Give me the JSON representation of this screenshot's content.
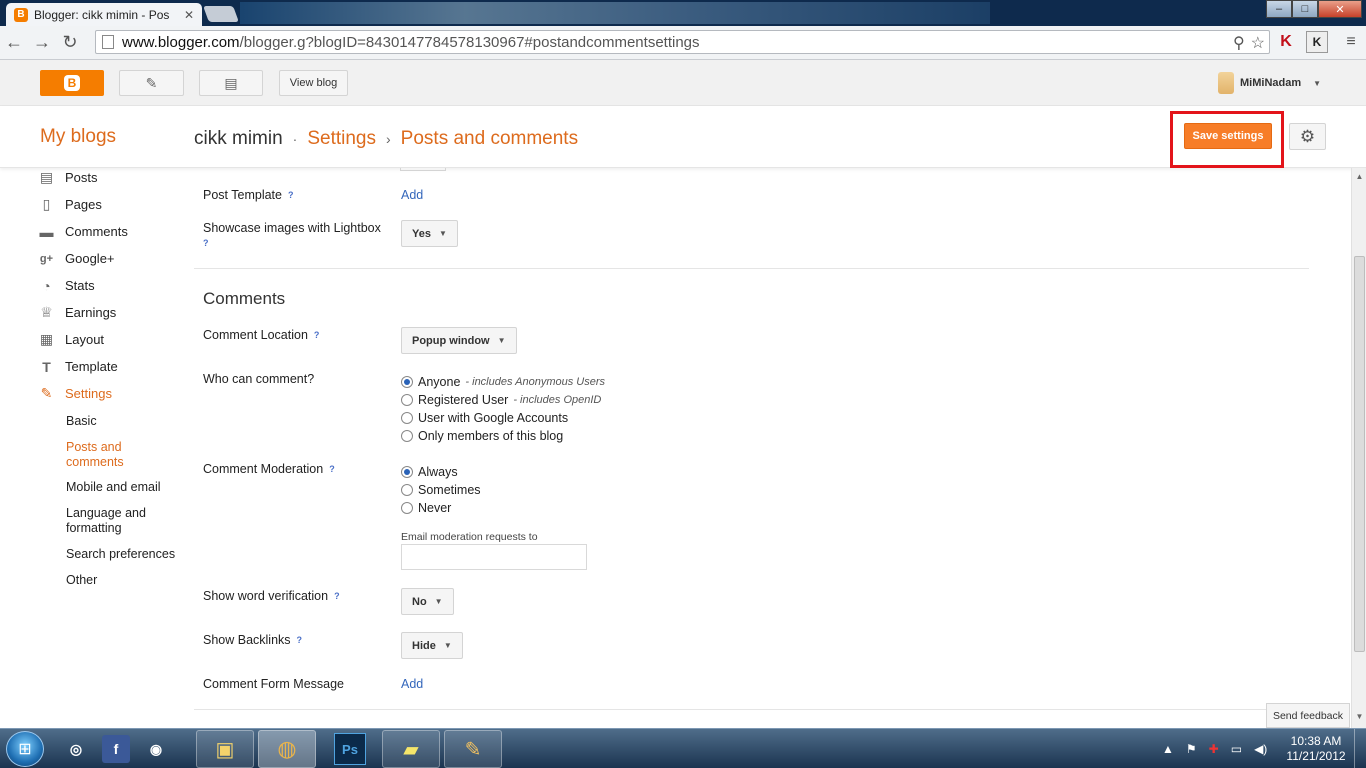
{
  "browser": {
    "tab_title": "Blogger: cikk mimin - Pos",
    "tab_close": "✕",
    "favicon_letter": "B",
    "url_host": "www.blogger.com",
    "url_path": "/blogger.g?blogID=8430147784578130967#postandcommentsettings",
    "window_controls": {
      "minimize": "–",
      "maximize": "□",
      "close": "✕"
    },
    "nav": {
      "back": "←",
      "forward": "→",
      "reload": "↻"
    },
    "omnibox_icons": {
      "search": "⚲",
      "star": "☆"
    },
    "extensions": {
      "kaspersky": "K",
      "k_ext": "K",
      "menu": "≡"
    }
  },
  "blogger_header": {
    "logo_letter": "B",
    "new_post_icon": "✎",
    "posts_icon": "▤",
    "view_blog": "View blog",
    "username": "MiMiNadam",
    "user_caret": "▼"
  },
  "titlebar": {
    "my_blogs": "My blogs",
    "blog_name": "cikk mimin",
    "sep1": "·",
    "settings_link": "Settings",
    "sep2": "›",
    "page": "Posts and comments",
    "save_button": "Save settings",
    "gear_icon": "⚙"
  },
  "sidebar": {
    "items": [
      {
        "label": "Posts",
        "icon": "▤"
      },
      {
        "label": "Pages",
        "icon": "▯"
      },
      {
        "label": "Comments",
        "icon": "▬"
      },
      {
        "label": "Google+",
        "icon": "g+"
      },
      {
        "label": "Stats",
        "icon": "◔"
      },
      {
        "label": "Earnings",
        "icon": "♕"
      },
      {
        "label": "Layout",
        "icon": "▦"
      },
      {
        "label": "Template",
        "icon": "T"
      },
      {
        "label": "Settings",
        "icon": "✎"
      }
    ],
    "sub_items": [
      "Basic",
      "Posts and comments",
      "Mobile and email",
      "Language and formatting",
      "Search preferences",
      "Other"
    ]
  },
  "posts_section": {
    "post_template_label": "Post Template",
    "post_template_link": "Add",
    "lightbox_label": "Showcase images with Lightbox",
    "lightbox_value": "Yes",
    "help": "?"
  },
  "comments_section": {
    "title": "Comments",
    "location_label": "Comment Location",
    "location_value": "Popup window",
    "who_label": "Who can comment?",
    "who_options": [
      {
        "label": "Anyone",
        "note": " - includes Anonymous Users",
        "selected": true
      },
      {
        "label": "Registered User",
        "note": " - includes OpenID",
        "selected": false
      },
      {
        "label": "User with Google Accounts",
        "note": "",
        "selected": false
      },
      {
        "label": "Only members of this blog",
        "note": "",
        "selected": false
      }
    ],
    "moderation_label": "Comment Moderation",
    "moderation_options": [
      {
        "label": "Always",
        "selected": true
      },
      {
        "label": "Sometimes",
        "selected": false
      },
      {
        "label": "Never",
        "selected": false
      }
    ],
    "email_moderation_label": "Email moderation requests to",
    "email_moderation_value": "",
    "word_verification_label": "Show word verification",
    "word_verification_value": "No",
    "backlinks_label": "Show Backlinks",
    "backlinks_value": "Hide",
    "form_message_label": "Comment Form Message",
    "form_message_link": "Add",
    "dropdown_caret": "▼"
  },
  "feedback": "Send feedback",
  "taskbar": {
    "start_icon": "⊞",
    "pinned": [
      "◎",
      "f",
      "◉",
      "▣",
      "◍",
      "Ps",
      "▰",
      "✎"
    ],
    "tray_icons": [
      "▲",
      "⚑",
      "✚",
      "▭",
      "◀)"
    ],
    "time": "10:38 AM",
    "date": "11/21/2012"
  },
  "colors": {
    "accent": "#dd6b1d",
    "save_button": "#f77d28",
    "highlight_box": "#e3141a",
    "link": "#3366bb"
  }
}
